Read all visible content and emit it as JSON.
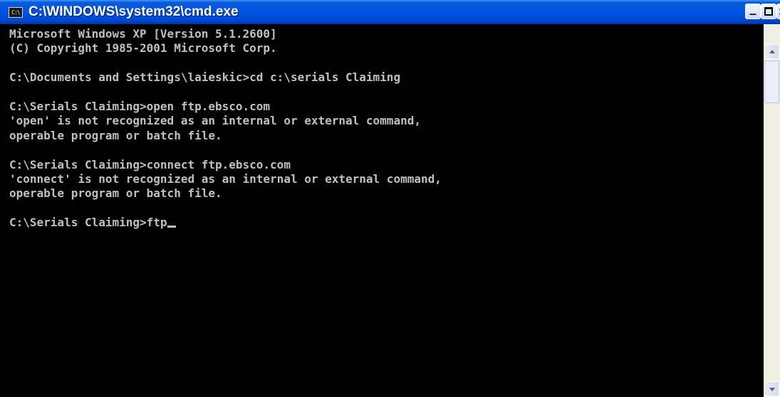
{
  "window": {
    "title": "C:\\WINDOWS\\system32\\cmd.exe",
    "icon": "console-icon",
    "icon_glyph": "C:\\",
    "controls": {
      "minimize": "minimize-icon",
      "maximize": "maximize-icon",
      "close": "close-icon"
    }
  },
  "console": {
    "lines": [
      "Microsoft Windows XP [Version 5.1.2600]",
      "(C) Copyright 1985-2001 Microsoft Corp.",
      "",
      "C:\\Documents and Settings\\laieskic>cd c:\\serials Claiming",
      "",
      "C:\\Serials Claiming>open ftp.ebsco.com",
      "'open' is not recognized as an internal or external command,",
      "operable program or batch file.",
      "",
      "C:\\Serials Claiming>connect ftp.ebsco.com",
      "'connect' is not recognized as an internal or external command,",
      "operable program or batch file.",
      ""
    ],
    "prompt": "C:\\Serials Claiming>",
    "input": "ftp"
  },
  "colors": {
    "console_background": "#000000",
    "console_text": "#c0c0c0",
    "titlebar": "#0054e3"
  }
}
